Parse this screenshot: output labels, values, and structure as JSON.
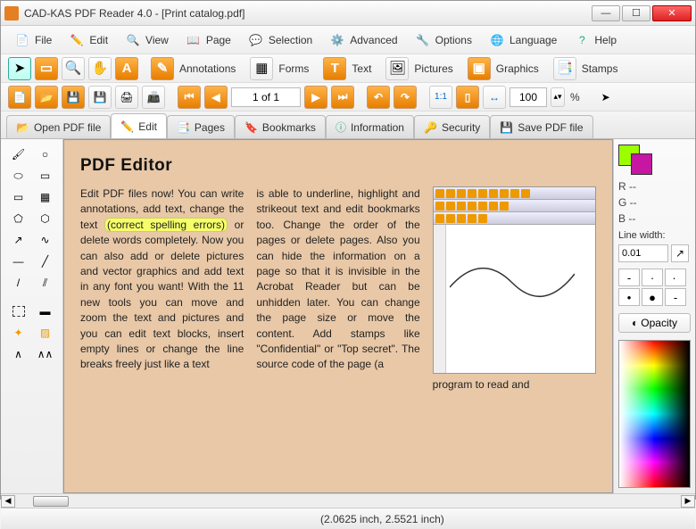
{
  "window": {
    "title": "CAD-KAS PDF Reader 4.0 - [Print catalog.pdf]"
  },
  "menu": {
    "file": "File",
    "edit": "Edit",
    "view": "View",
    "page": "Page",
    "selection": "Selection",
    "advanced": "Advanced",
    "options": "Options",
    "language": "Language",
    "help": "Help"
  },
  "toolbar1": {
    "annotations": "Annotations",
    "forms": "Forms",
    "text": "Text",
    "pictures": "Pictures",
    "graphics": "Graphics",
    "stamps": "Stamps"
  },
  "nav": {
    "page": "1 of 1",
    "zoom": "100",
    "zoom_unit": "%"
  },
  "tabs": {
    "open": "Open PDF file",
    "edit": "Edit",
    "pages": "Pages",
    "bookmarks": "Bookmarks",
    "information": "Information",
    "security": "Security",
    "save": "Save PDF file"
  },
  "doc": {
    "heading": "PDF Editor",
    "col1a": "Edit PDF files now! You can write annotations, add text, change the text ",
    "col1hl": "(correct spelling errors)",
    "col1b": " or delete words completely. Now you can also add or delete pictures and vector graphics and add text in any font you want! With the 11 new tools you can move and zoom the text and pictures and you can edit text blocks, insert empty lines or change the line breaks freely just like a text",
    "col2": "is able to underline, highlight and strikeout text and edit bookmarks too. Change the order of the pages or delete pages. Also you can hide the information on a page so that it is invisible in the Acrobat Reader but can be unhidden later. You can change the page size or move the content. Add stamps like \"Confidential\" or \"Top secret\". The source code of the page (a",
    "col3tail": "program to read and"
  },
  "right": {
    "r": "R --",
    "g": "G --",
    "b": "B --",
    "linewidth_label": "Line width:",
    "linewidth": "0.01",
    "opacity": "Opacity"
  },
  "status": {
    "coords": "(2.0625 inch, 2.5521 inch)"
  },
  "colors": {
    "swatch1": "#9bff00",
    "swatch2": "#c517a1"
  }
}
